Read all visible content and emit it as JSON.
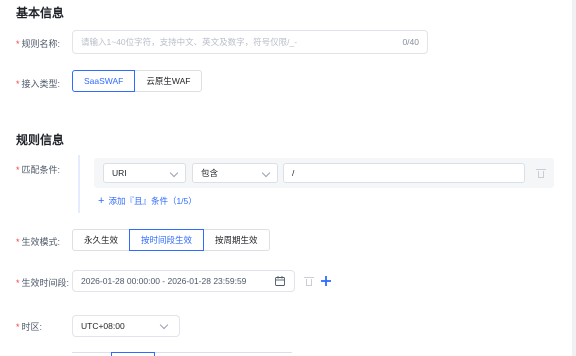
{
  "basic": {
    "title": "基本信息",
    "rule_name": {
      "label": "规则名称:",
      "placeholder": "请输入1~40位字符，支持中文、英文及数字，符号仅限/_-",
      "counter": "0/40"
    },
    "access_type": {
      "label": "接入类型:",
      "options": [
        "SaaSWAF",
        "云原生WAF"
      ],
      "selected": "SaaSWAF"
    }
  },
  "rule": {
    "title": "规则信息",
    "match": {
      "label": "匹配条件:",
      "field": "URI",
      "operator": "包含",
      "value": "/",
      "add_label": "添加『且』条件（1/5）"
    },
    "effect_mode": {
      "label": "生效模式:",
      "options": [
        "永久生效",
        "按时间段生效",
        "按周期生效"
      ],
      "selected": "按时间段生效"
    },
    "time_range": {
      "label": "生效时间段:",
      "value": "2026-01-28 00:00:00 - 2026-01-28 23:59:59"
    },
    "timezone": {
      "label": "时区:",
      "value": "UTC+08:00"
    }
  },
  "colors": {
    "accent": "#2f6bff",
    "required": "#f53f3f"
  }
}
